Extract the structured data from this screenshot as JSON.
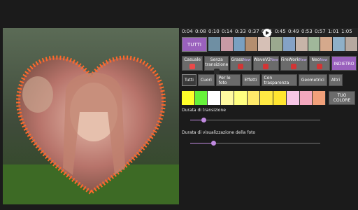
{
  "timeline": {
    "ticks": [
      "0:04",
      "0:08",
      "0:10",
      "0:14",
      "0:33",
      "0:37",
      "0:41",
      "0:45",
      "0:49",
      "0:53",
      "0:57",
      "1:01",
      "1:05"
    ],
    "thumbnails": [
      "#6f8fa3",
      "#c89aa5",
      "#7aa0c1",
      "#b48e6f",
      "#d6c0b6",
      "#9ba98f",
      "#84a2c6",
      "#c7b4a8",
      "#a0b79a",
      "#d5a98c",
      "#8fb0c8",
      "#b7a9a0"
    ],
    "play_icon": "play-icon"
  },
  "tutti_label": "TUTTI",
  "categories": [
    {
      "label": "Casuale",
      "icon_color": "#e94a4a",
      "new": ""
    },
    {
      "label": "Senza transizione",
      "icon_color": "#2b2b2b",
      "new": ""
    },
    {
      "label": "Grass",
      "icon_color": "#d23535",
      "new": "New"
    },
    {
      "label": "WaveV2",
      "icon_color": "#d23535",
      "new": "New"
    },
    {
      "label": "FireWork",
      "icon_color": "#d23535",
      "new": "New"
    },
    {
      "label": "Neo",
      "icon_color": "#d23535",
      "new": "New"
    }
  ],
  "back_label": "INDIETRO",
  "filters": [
    "Tutti",
    "Cuori",
    "Per le foto",
    "Effetti",
    "Con trasparenza",
    "Geometrici",
    "Altri"
  ],
  "active_filter": "Tutti",
  "swatches": [
    "#ffff2a",
    "#66f23a",
    "#ffffff",
    "#fffaa0",
    "#ffff80",
    "#ffea6a",
    "#ffea44",
    "#ffe630",
    "#f7c6e6",
    "#f3a8be",
    "#f1a07a"
  ],
  "your_color": "TUO COLORE",
  "slider1": {
    "label": "Durata di transizione",
    "value": 0.1
  },
  "slider2": {
    "label": "Durata di visualizzazione della foto",
    "value": 0.18
  },
  "accent": "#9a61bd"
}
